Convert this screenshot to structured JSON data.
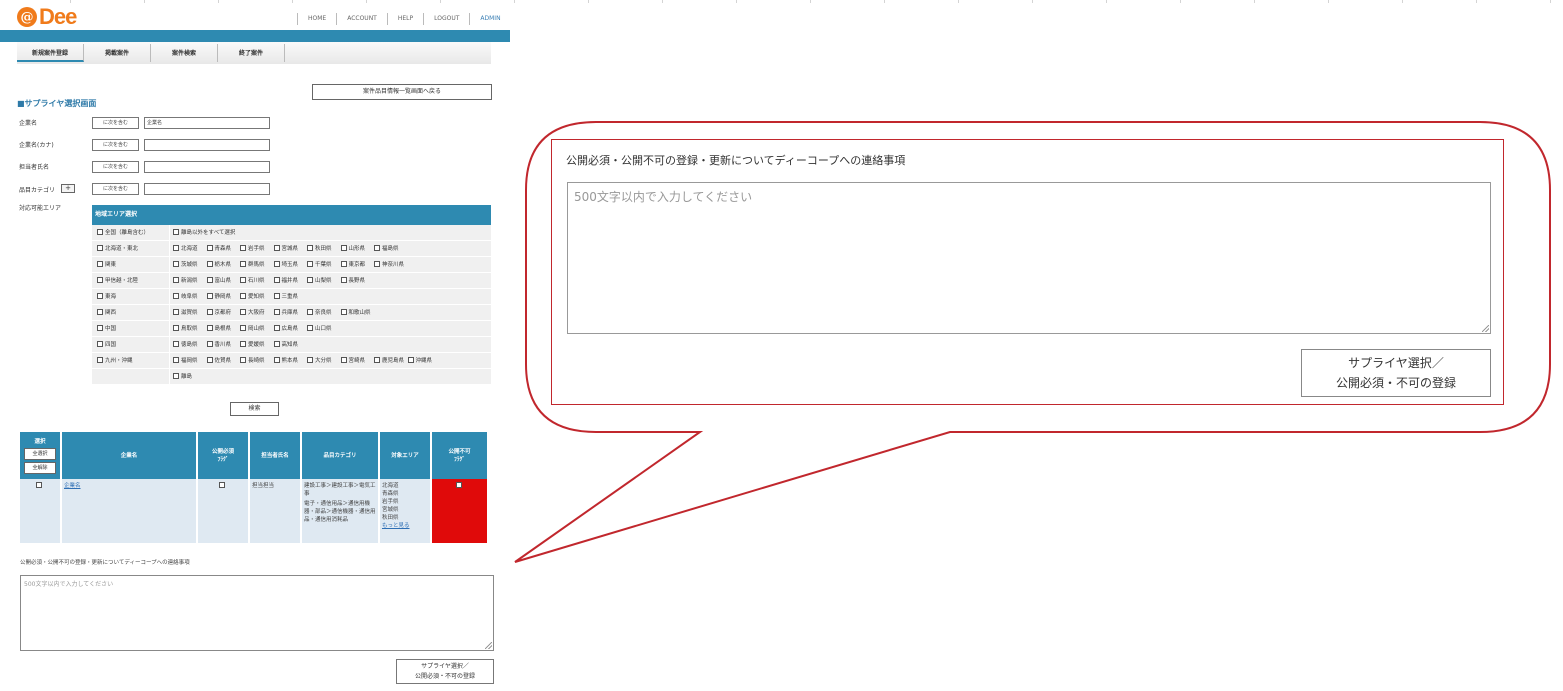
{
  "header": {
    "logo_text": "Dee",
    "logo_mark": "@",
    "nav": [
      "HOME",
      "ACCOUNT",
      "HELP",
      "LOGOUT",
      "ADMIN"
    ]
  },
  "subnav": [
    "新規案件登録",
    "掲載案件",
    "案件検索",
    "終了案件"
  ],
  "back_button": "案件品目情報一覧画面へ戻る",
  "section_title": "■サプライヤ選択画面",
  "form": {
    "company_label": "企業名",
    "company_kana_label": "企業名(カナ)",
    "contact_person_label": "担当者氏名",
    "category_label": "品目カテゴリ",
    "area_label": "対応可能エリア",
    "condition": "に次を含む",
    "company_value": "企業名",
    "plus": "+"
  },
  "area_table": {
    "header": "地域エリア選択",
    "rows": [
      {
        "region": "全国（離島含む）",
        "prefs": [
          "離島以外をすべて選択"
        ]
      },
      {
        "region": "北海道・東北",
        "prefs": [
          "北海道",
          "青森県",
          "岩手県",
          "宮城県",
          "秋田県",
          "山形県",
          "福島県"
        ]
      },
      {
        "region": "関東",
        "prefs": [
          "茨城県",
          "栃木県",
          "群馬県",
          "埼玉県",
          "千葉県",
          "東京都",
          "神奈川県"
        ]
      },
      {
        "region": "甲信越・北陸",
        "prefs": [
          "新潟県",
          "富山県",
          "石川県",
          "福井県",
          "山梨県",
          "長野県"
        ]
      },
      {
        "region": "東海",
        "prefs": [
          "岐阜県",
          "静岡県",
          "愛知県",
          "三重県"
        ]
      },
      {
        "region": "関西",
        "prefs": [
          "滋賀県",
          "京都府",
          "大阪府",
          "兵庫県",
          "奈良県",
          "和歌山県"
        ]
      },
      {
        "region": "中国",
        "prefs": [
          "鳥取県",
          "島根県",
          "岡山県",
          "広島県",
          "山口県"
        ]
      },
      {
        "region": "四国",
        "prefs": [
          "徳島県",
          "香川県",
          "愛媛県",
          "高知県"
        ]
      },
      {
        "region": "九州・沖縄",
        "prefs": [
          "福岡県",
          "佐賀県",
          "長崎県",
          "熊本県",
          "大分県",
          "宮崎県",
          "鹿児島県",
          "沖縄県"
        ]
      },
      {
        "region": "",
        "prefs": [
          "離島"
        ]
      }
    ]
  },
  "search_button": "検索",
  "result_table": {
    "headers": {
      "select": "選択",
      "select_all": "全選択",
      "deselect_all": "全解除",
      "company": "企業名",
      "public_required": "公開必須",
      "public_required_sub": "ﾌﾗｸﾞ",
      "contact": "担当者氏名",
      "category": "品目カテゴリ",
      "area": "対象エリア",
      "public_disallowed": "公開不可",
      "public_disallowed_sub": "ﾌﾗｸﾞ"
    },
    "row": {
      "company": "企業名",
      "contact": "担当担当",
      "category_1": "建設工事＞建設工事＞電気工事",
      "category_2": "電子・通信用品＞通信用機器・部品＞通信機器・通信用品・通信用消耗品",
      "areas": [
        "北海道",
        "青森県",
        "岩手県",
        "宮城県",
        "秋田県"
      ],
      "more_link": "もっと見る"
    }
  },
  "contact": {
    "label": "公開必須・公開不可の登録・更新についてディーコープへの連絡事項",
    "placeholder": "500文字以内で入力してください",
    "button_line1": "サプライヤ選択／",
    "button_line2": "公開必須・不可の登録"
  },
  "colors": {
    "brand_orange": "#f07b1b",
    "header_blue": "#2e8ab1",
    "disallowed_red": "#e00a0a",
    "bubble_red": "#c1272d"
  }
}
